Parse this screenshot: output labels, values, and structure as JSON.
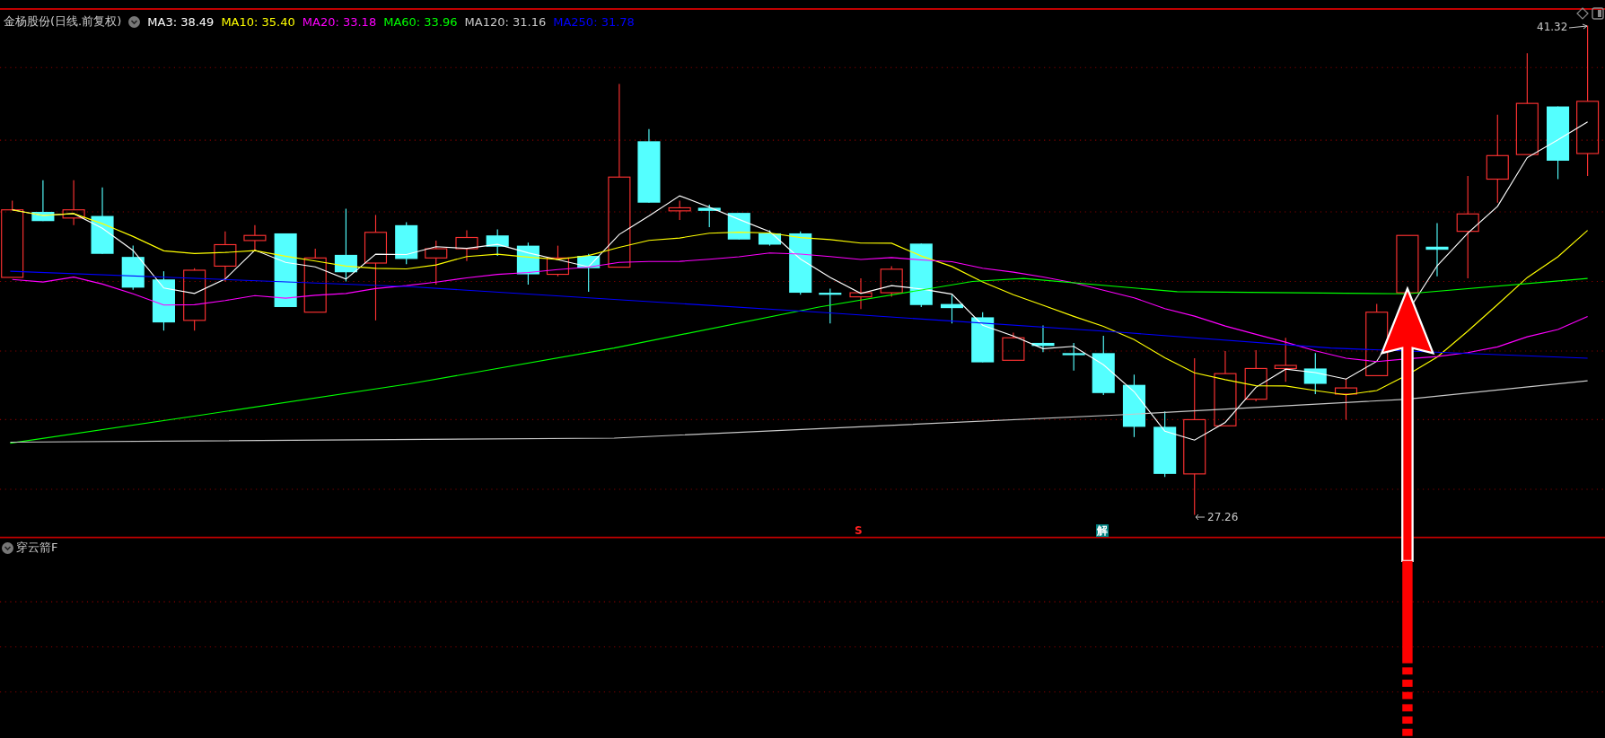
{
  "chart_title": "金杨股份(日线.前复权)",
  "ma_legend": [
    {
      "label": "MA3: 38.49",
      "color": "#ffffff"
    },
    {
      "label": "MA10: 35.40",
      "color": "#ffff00"
    },
    {
      "label": "MA20: 33.18",
      "color": "#ff00ff"
    },
    {
      "label": "MA60: 33.96",
      "color": "#00ff00"
    },
    {
      "label": "MA120: 31.16",
      "color": "#c8c8c8"
    },
    {
      "label": "MA250: 31.78",
      "color": "#0000ff"
    }
  ],
  "high_label": "41.32",
  "low_label": "27.26",
  "signal_markers": [
    {
      "text": "S",
      "kind": "sell"
    },
    {
      "text": "解",
      "kind": "unlock"
    }
  ],
  "indicator_panel": {
    "title": "穿云箭F"
  }
}
